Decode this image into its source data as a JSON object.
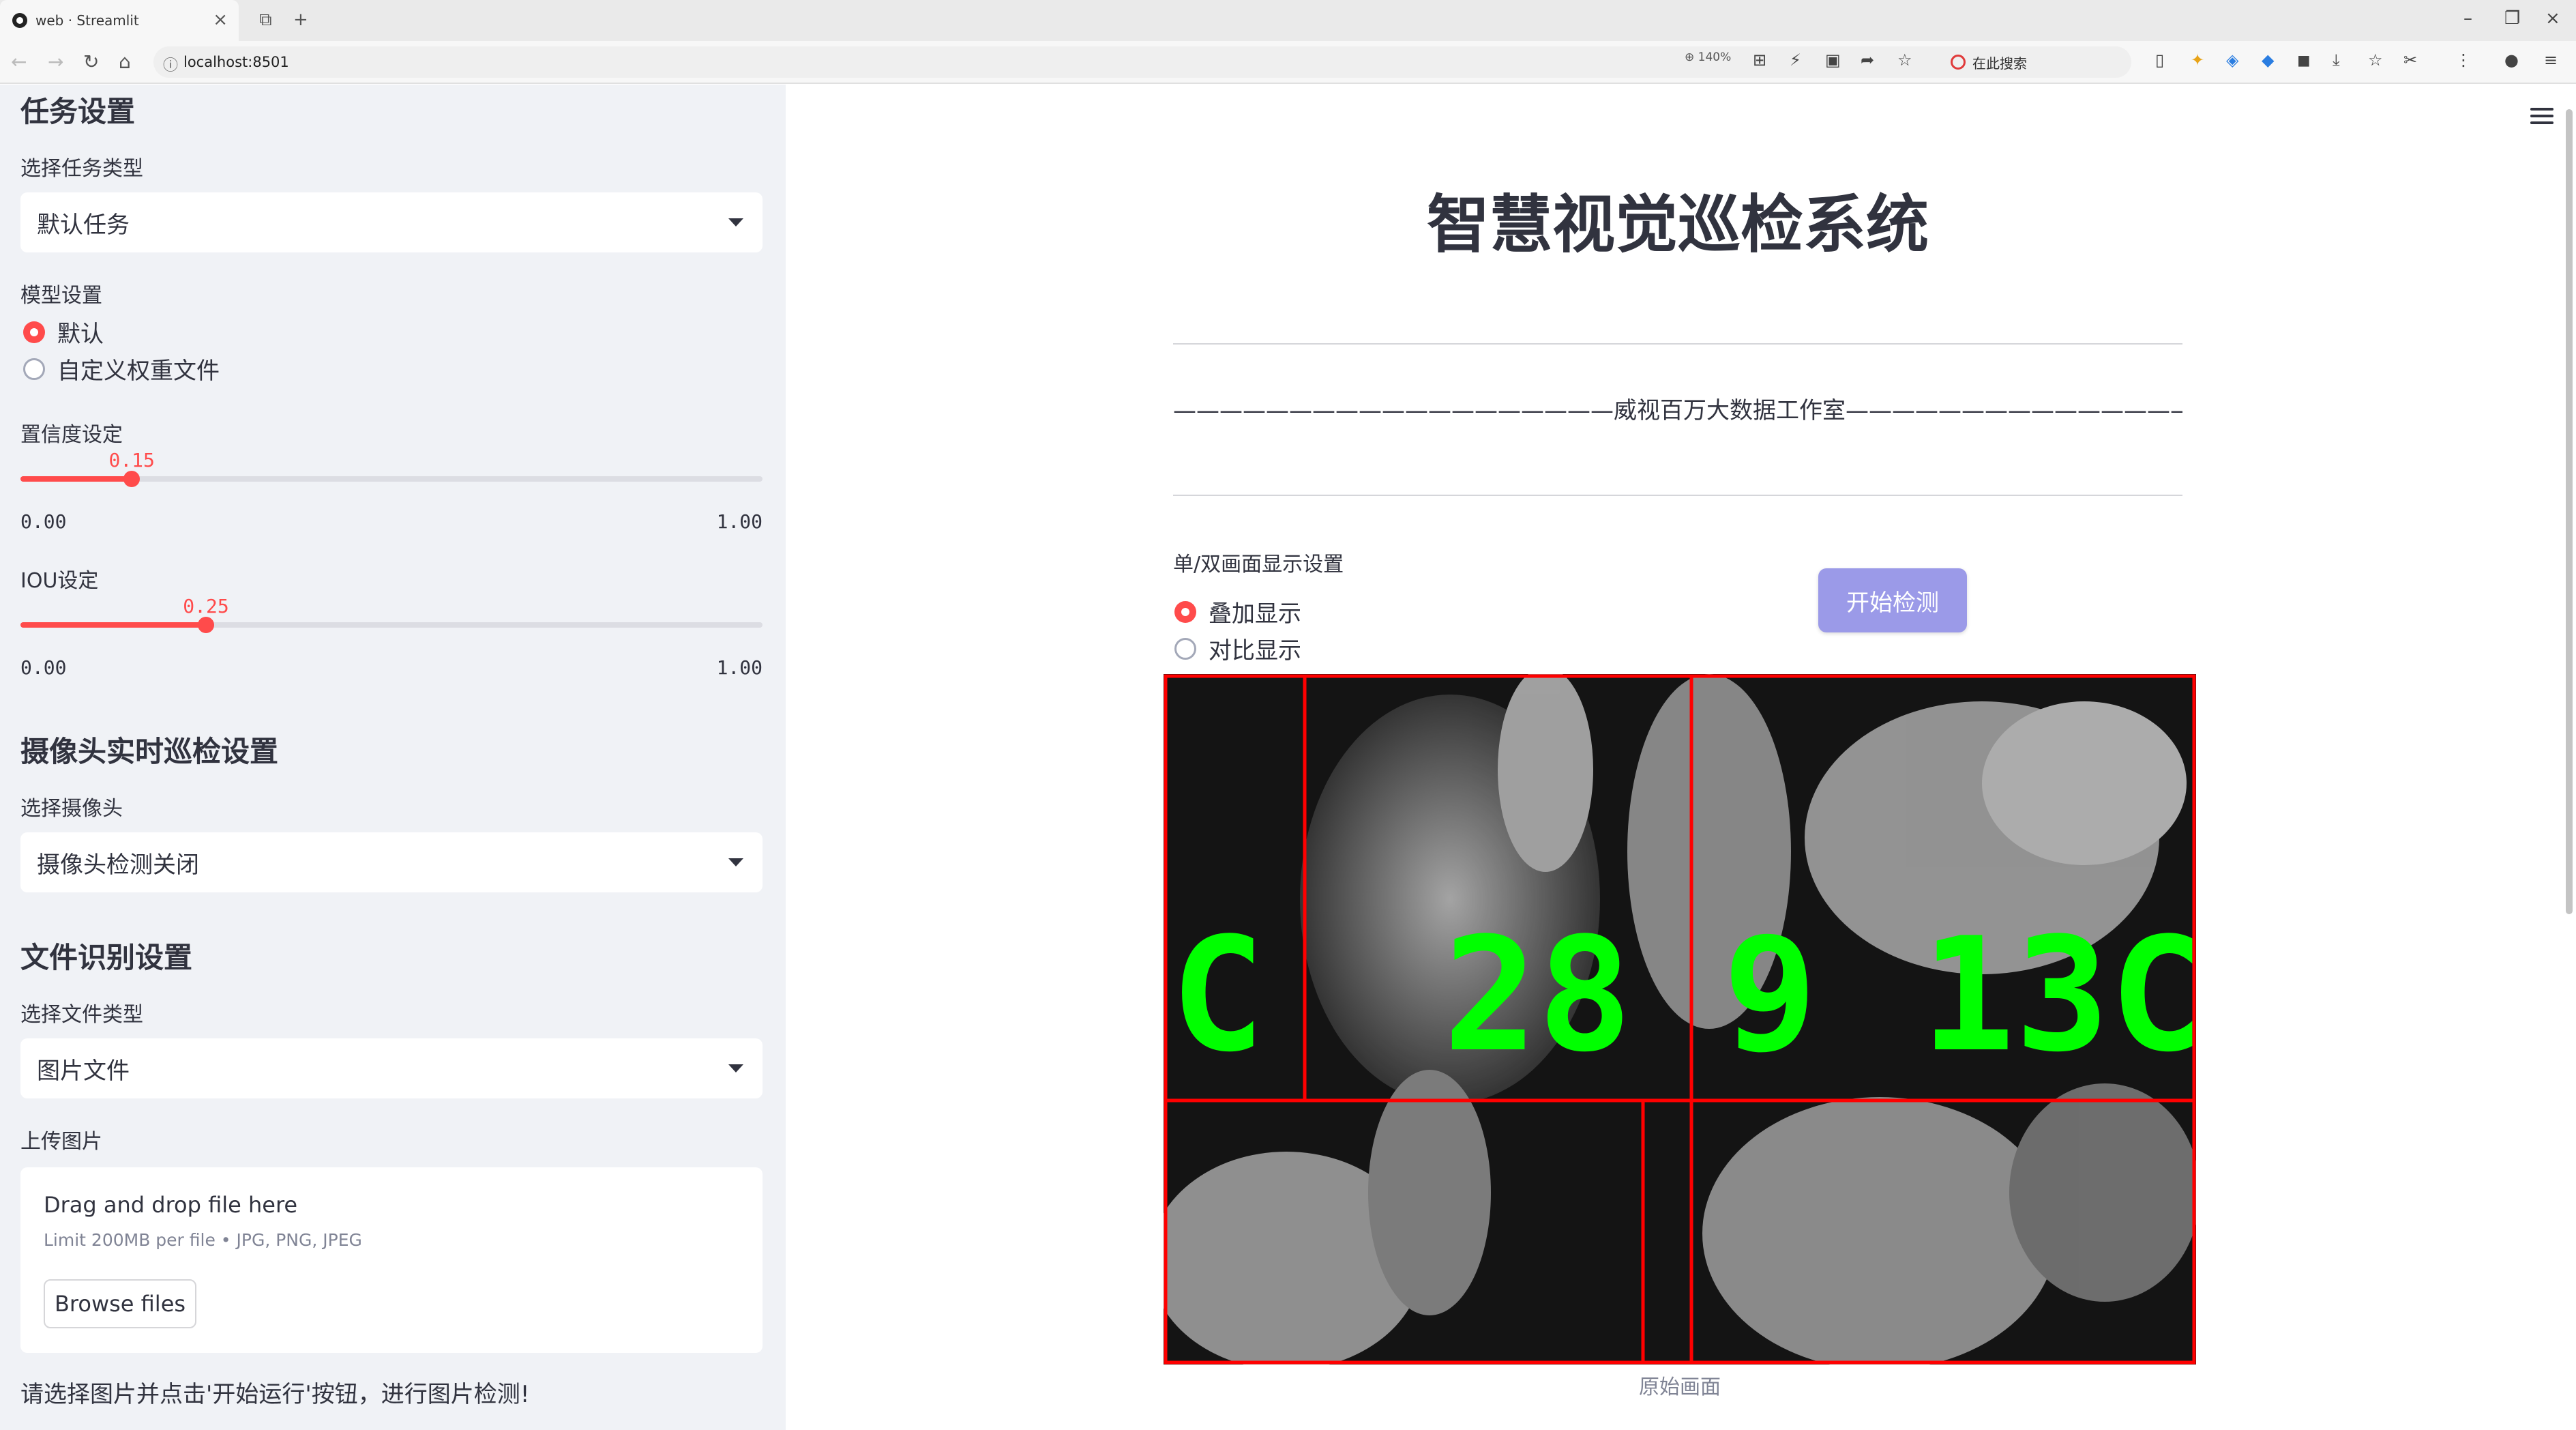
{
  "browser": {
    "tab_title": "web · Streamlit",
    "url": "localhost:8501",
    "zoom": "140%",
    "search_label": "在此搜索"
  },
  "sidebar": {
    "task_header": "任务设置",
    "task_label": "选择任务类型",
    "task_value": "默认任务",
    "model_label": "模型设置",
    "model_options": [
      "默认",
      "自定义权重文件"
    ],
    "model_selected": "默认",
    "conf_label": "置信度设定",
    "conf_value": "0.15",
    "conf_min": "0.00",
    "conf_max": "1.00",
    "conf_fraction": 0.15,
    "iou_label": "IOU设定",
    "iou_value": "0.25",
    "iou_min": "0.00",
    "iou_max": "1.00",
    "iou_fraction": 0.25,
    "camera_header": "摄像头实时巡检设置",
    "camera_label": "选择摄像头",
    "camera_value": "摄像头检测关闭",
    "file_header": "文件识别设置",
    "file_type_label": "选择文件类型",
    "file_type_value": "图片文件",
    "upload_label": "上传图片",
    "upload_drag": "Drag and drop file here",
    "upload_limit": "Limit 200MB per file • JPG, PNG, JPEG",
    "browse_button": "Browse files",
    "hint": "请选择图片并点击'开始运行'按钮，进行图片检测!"
  },
  "main": {
    "title": "智慧视觉巡检系统",
    "subtitle": "———————————————————威视百万大数据工作室————————————————————",
    "display_label": "单/双画面显示设置",
    "display_options": [
      "叠加显示",
      "对比显示"
    ],
    "display_selected": "叠加显示",
    "start_button": "开始检测",
    "image_detections": [
      "C",
      "28",
      "9",
      "13C"
    ],
    "image_caption": "原始画面"
  },
  "colors": {
    "accent": "#ff4b4b",
    "button": "#9b9ae8",
    "box": "#ff0000",
    "label": "#00ff00"
  }
}
